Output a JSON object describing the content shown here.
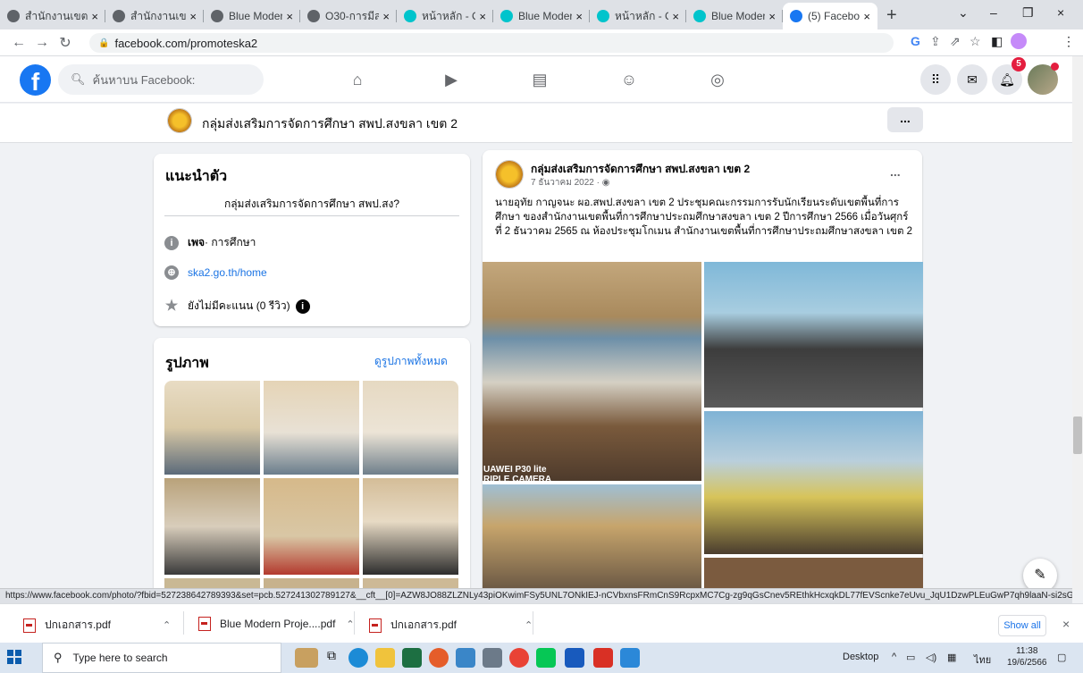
{
  "browser": {
    "tabs": [
      {
        "title": "สำนักงานเขต",
        "favicon_color": "#5f6368"
      },
      {
        "title": "สำนักงานเขต",
        "favicon_color": "#5f6368"
      },
      {
        "title": "Blue Moder",
        "favicon_color": "#5f6368"
      },
      {
        "title": "O30-การมีส่",
        "favicon_color": "#5f6368"
      },
      {
        "title": "หน้าหลัก - Ca",
        "favicon_color": "#00c4cc"
      },
      {
        "title": "Blue Moder",
        "favicon_color": "#00c4cc"
      },
      {
        "title": "หน้าหลัก - Ca",
        "favicon_color": "#00c4cc"
      },
      {
        "title": "Blue Moder",
        "favicon_color": "#00c4cc"
      },
      {
        "title": "(5) Faceboo",
        "favicon_color": "#1877f2"
      }
    ],
    "new_tab": "+",
    "close_glyph": "×",
    "url": "facebook.com/promoteska2",
    "status_url": "https://www.facebook.com/photo/?fbid=527238642789393&set=pcb.527241302789127&__cft__[0]=AZW8JO88ZLZNLy43piOKwimFSy5UNL7ONkIEJ-nCVbxnsFRmCnS9RcpxMC7Cg-zg9qGsCnev5REthkHcxqkDL77fEVScnke7eUvu_JqU1DzwPLEuGwP7qh9laaN-si2sGl..."
  },
  "facebook": {
    "logo": "f",
    "search_placeholder": "ค้นหาบน Facebook:",
    "notification_count": "5",
    "page_name": "กลุ่มส่งเสริมการจัดการศึกษา สพป.สงขลา เขต 2",
    "more": "...",
    "intro": {
      "title": "แนะนำตัว",
      "description": "กลุ่มส่งเสริมการจัดการศึกษา สพป.สง?",
      "page_type_bold": "เพจ",
      "page_type": " · การศึกษา",
      "website": "ska2.go.th/home",
      "rating": "ยังไม่มีคะแนน (0 รีวิว)"
    },
    "photos": {
      "title": "รูปภาพ",
      "see_all": "ดูรูปภาพทั้งหมด"
    },
    "post": {
      "author": "กลุ่มส่งเสริมการจัดการศึกษา สพป.สงขลา เขต 2",
      "date": "7 ธันวาคม 2022 · ",
      "text": "นายอุทัย กาญจนะ ผอ.สพป.สงขลา เขต 2 ประชุมคณะกรรมการรับนักเรียนระดับเขตพื้นที่การศึกษา ของสำนักงานเขตพื้นที่การศึกษาประถมศึกษาสงขลา เขต 2 ปีการศึกษา 2566 เมื่อวันศุกร์ ที่ 2 ธันวาคม 2565 ณ ห้องประชุมโกเมน สำนักงานเขตพื้นที่การศึกษาประถมศึกษาสงขลา เขต 2",
      "watermark_line1": "UAWEI P30 lite",
      "watermark_line2": "RIPLE CAMERA"
    }
  },
  "downloads": {
    "items": [
      "ปกเอกสาร.pdf",
      "Blue Modern Proje....pdf",
      "ปกเอกสาร.pdf"
    ],
    "show_all": "Show all"
  },
  "taskbar": {
    "search_placeholder": "Type here to search",
    "desktop_label": "Desktop",
    "lang": "ไทย",
    "time": "11:38",
    "date": "19/6/2566"
  }
}
